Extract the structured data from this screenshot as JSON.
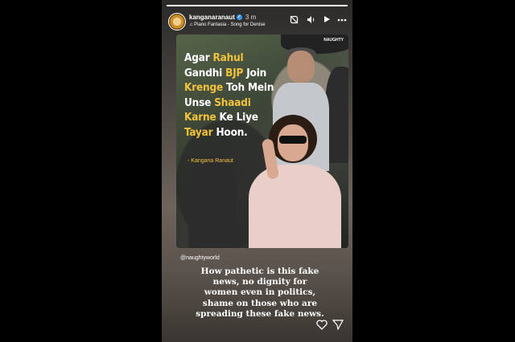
{
  "story": {
    "username": "kanganaranaut",
    "time": "3 m",
    "music": "Piano Fantasia - Song for Denise",
    "icons": [
      "mute-icon",
      "volume-icon",
      "play-icon",
      "more-icon"
    ]
  },
  "post": {
    "quote_parts": [
      {
        "t": "Agar ",
        "h": false
      },
      {
        "t": "Rahul",
        "h": true
      },
      {
        "t": " ",
        "h": false
      },
      {
        "t": "Gandhi ",
        "h": false
      },
      {
        "t": "BJP",
        "h": true
      },
      {
        "t": " Join ",
        "h": false
      },
      {
        "t": "Krenge",
        "h": true
      },
      {
        "t": " Toh Mein ",
        "h": false
      },
      {
        "t": "Unse ",
        "h": false
      },
      {
        "t": "Shaadi",
        "h": true
      },
      {
        "t": " ",
        "h": false
      },
      {
        "t": "Karne",
        "h": true
      },
      {
        "t": " Ke Liye ",
        "h": false
      },
      {
        "t": "Tayar",
        "h": true
      },
      {
        "t": " Hoon.",
        "h": false
      }
    ],
    "attribution": "- Kangana Ranaut",
    "watermark": "NAUGHTY"
  },
  "handle": "@naughtyworld",
  "caption": "How pathetic is this fake news, no dignity for women even in politics, shame on those who are spreading these fake news.",
  "colors": {
    "highlight": "#f2c23c",
    "verified": "#3897f0"
  }
}
